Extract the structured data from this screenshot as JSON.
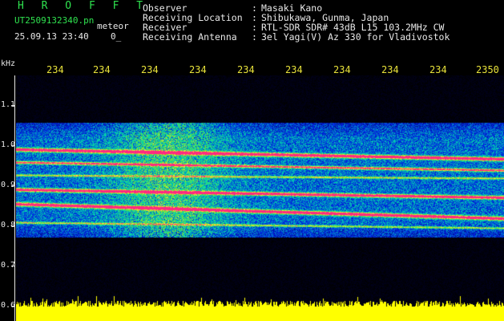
{
  "header": {
    "title": "H R O F F T",
    "file_name": "UT2509132340.pn",
    "file_suffix": "meteor",
    "datetime": "25.09.13 23:40",
    "counter": "0_"
  },
  "info": [
    {
      "label": "Observer",
      "value": "Masaki Kano"
    },
    {
      "label": "Receiving Location",
      "value": "Shibukawa, Gunma, Japan"
    },
    {
      "label": "Receiver",
      "value": "RTL-SDR SDR# 43dB L15 103.2MHz CW"
    },
    {
      "label": "Receiving Antenna",
      "value": "3el Yagi(V) Az 330 for Vladivostok"
    }
  ],
  "colon": ":",
  "unit": "kHz",
  "y_ticks": [
    "1.1",
    "1.0",
    "0.9",
    "0.8",
    "0.7",
    "0.6"
  ],
  "x_ticks": [
    "234",
    "234",
    "234",
    "234",
    "234",
    "234",
    "234",
    "234",
    "234",
    "2350"
  ],
  "colors": {
    "background": "#000000",
    "labels": "#e8e8e8",
    "title": "#2fe24f",
    "time_axis": "#e8e23a",
    "noise_floor": "#ffff00",
    "signal_strong": "#ff3070",
    "signal_mid": "#30e0a0",
    "signal_weak": "#1030c0"
  }
}
